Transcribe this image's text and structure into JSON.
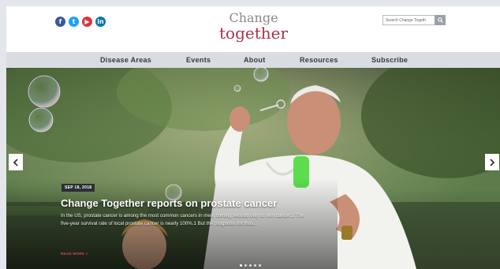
{
  "header": {
    "social": [
      {
        "icon": "facebook-icon",
        "glyph": "f"
      },
      {
        "icon": "twitter-icon",
        "glyph": "t"
      },
      {
        "icon": "youtube-icon",
        "glyph": "▶"
      },
      {
        "icon": "linkedin-icon",
        "glyph": "in"
      }
    ],
    "logo_line1": "Change",
    "logo_line2": "together",
    "search_placeholder": "Search Change Togeth"
  },
  "nav": {
    "items": [
      {
        "label": "Disease Areas"
      },
      {
        "label": "Events"
      },
      {
        "label": "About"
      },
      {
        "label": "Resources"
      },
      {
        "label": "Subscribe"
      }
    ]
  },
  "hero": {
    "date": "SEP 18, 2018",
    "headline": "Change Together reports on prostate cancer",
    "excerpt": "In the US, prostate cancer is among the most common cancers in men, coming second only to skin cancer.1 The five-year survival rate of local prostate cancer is nearly 100%.1 But the prognosis for thos...",
    "read_more": "READ MORE >",
    "slide_count": 5,
    "active_slide": 1
  },
  "colors": {
    "brand_red": "#a8324a",
    "nav_bg": "#d9dde2",
    "read_more": "#d8475f"
  }
}
